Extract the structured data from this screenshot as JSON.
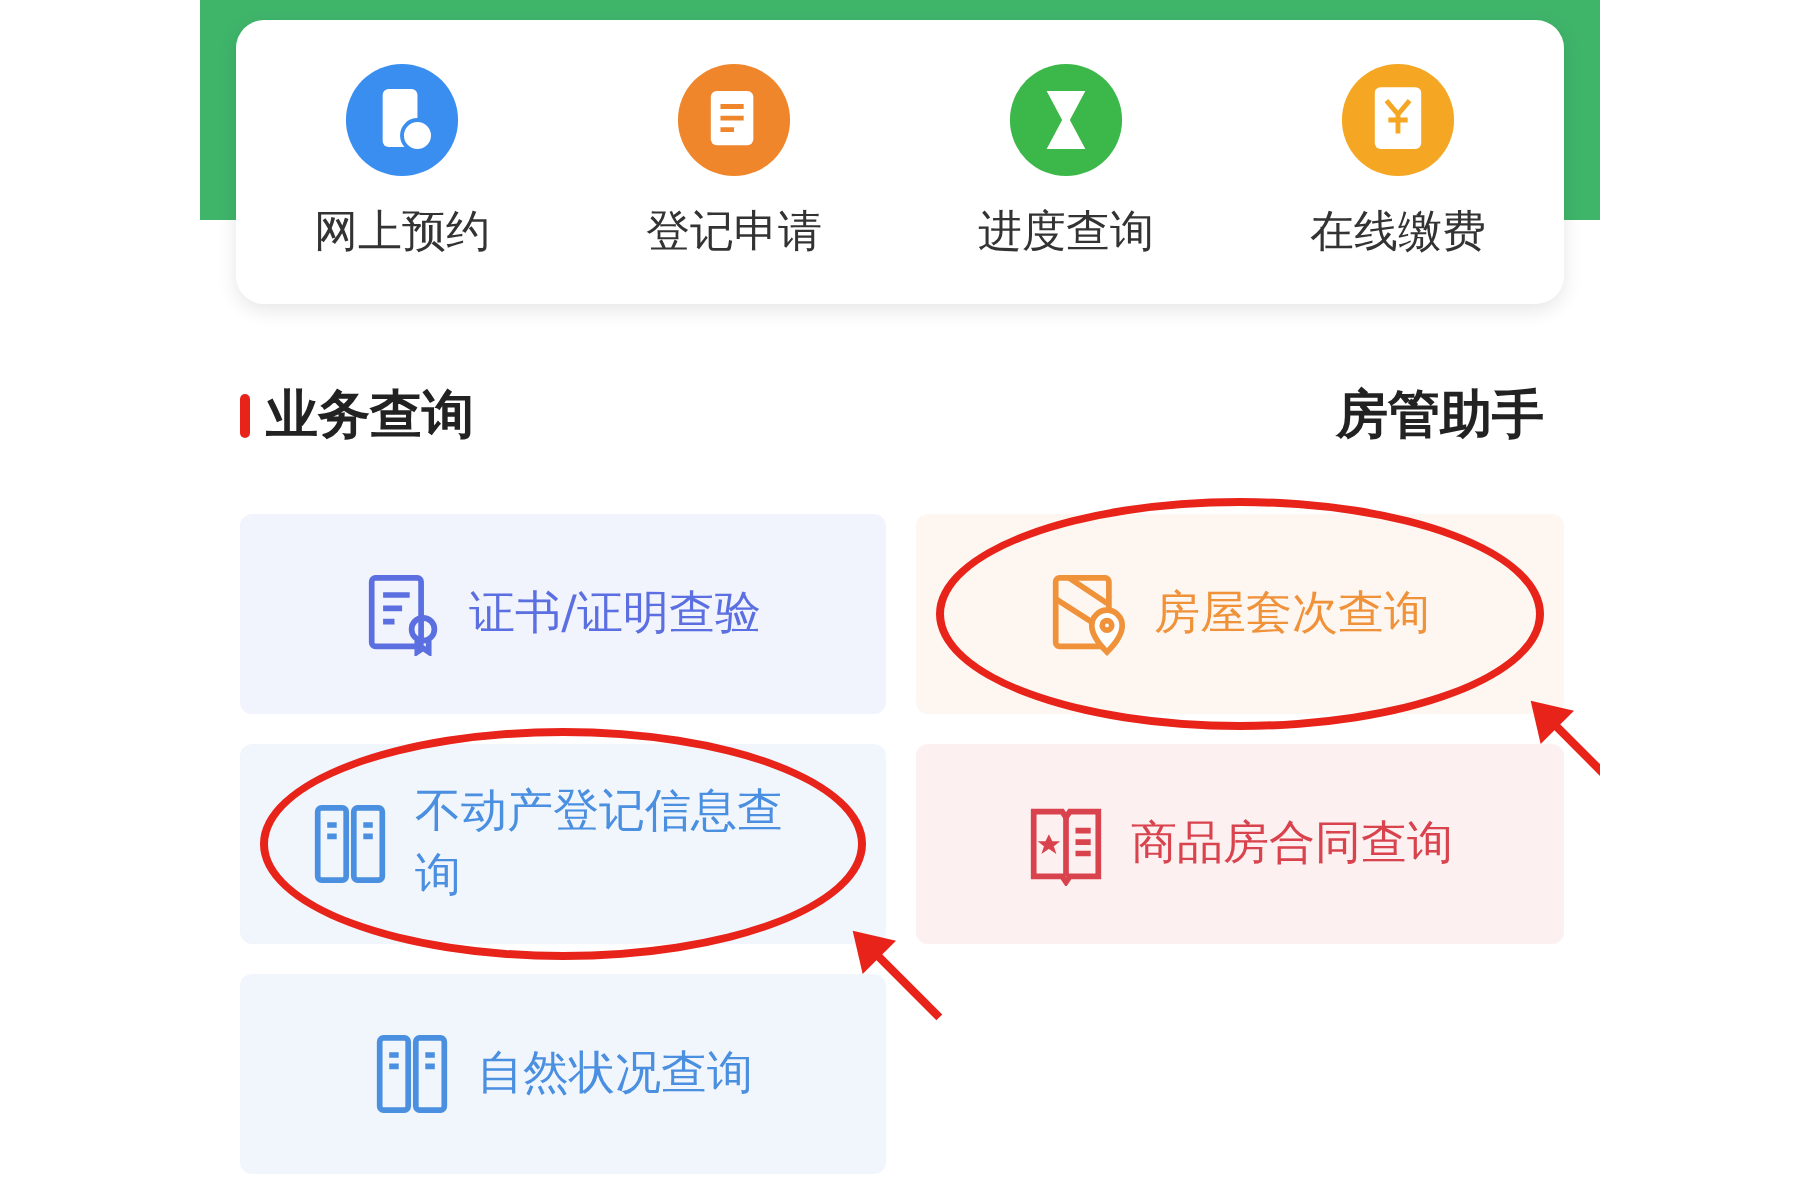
{
  "quick_actions": [
    {
      "label": "网上预约",
      "color": "#3a8ef0",
      "kind": "phone"
    },
    {
      "label": "登记申请",
      "color": "#f0862c",
      "kind": "form"
    },
    {
      "label": "进度查询",
      "color": "#3cb84a",
      "kind": "hourglass"
    },
    {
      "label": "在线缴费",
      "color": "#f5a623",
      "kind": "bill"
    }
  ],
  "section": {
    "title": "业务查询",
    "link": "房管助手"
  },
  "services": [
    {
      "label": "证书/证明查验",
      "color": "#5b6fe0",
      "kind": "certificate",
      "circled": false
    },
    {
      "label": "房屋套次查询",
      "color": "#f0923a",
      "kind": "house",
      "circled": true
    },
    {
      "label": "不动产登记信息查询",
      "color": "#4a8fe0",
      "kind": "binder",
      "circled": true
    },
    {
      "label": "商品房合同查询",
      "color": "#d9434d",
      "kind": "book",
      "circled": false
    },
    {
      "label": "自然状况查询",
      "color": "#4a8fe0",
      "kind": "binder",
      "circled": false
    }
  ]
}
